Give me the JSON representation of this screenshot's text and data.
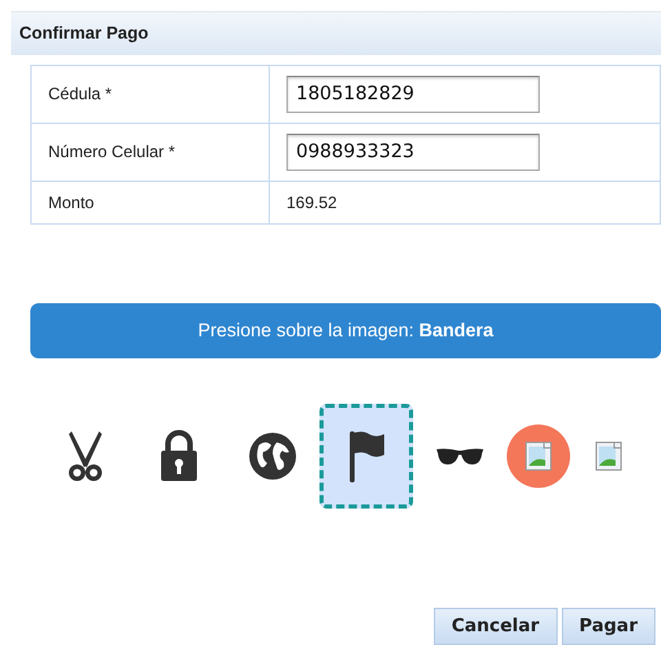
{
  "dialog": {
    "title": "Confirmar Pago"
  },
  "fields": [
    {
      "label": "Cédula *",
      "kind": "input",
      "value": "1805182829"
    },
    {
      "label": "Número Celular *",
      "kind": "input",
      "value": "0988933323"
    },
    {
      "label": "Monto",
      "kind": "text",
      "value": "169.52"
    }
  ],
  "instruction": "Presione sobre la imagen: **Bandera**",
  "captcha_options": [
    {
      "kind": "scissors",
      "selected": false
    },
    {
      "kind": "lock",
      "selected": false
    },
    {
      "kind": "globe",
      "selected": false
    },
    {
      "kind": "flag",
      "selected": true
    },
    {
      "kind": "glasses",
      "selected": false
    },
    {
      "kind": "image",
      "selected": false,
      "color": "#f4775a"
    },
    {
      "kind": "image",
      "selected": false,
      "color": "#ffffff"
    }
  ],
  "buttons": [
    {
      "label": "Cancelar"
    },
    {
      "label": "Pagar"
    }
  ]
}
